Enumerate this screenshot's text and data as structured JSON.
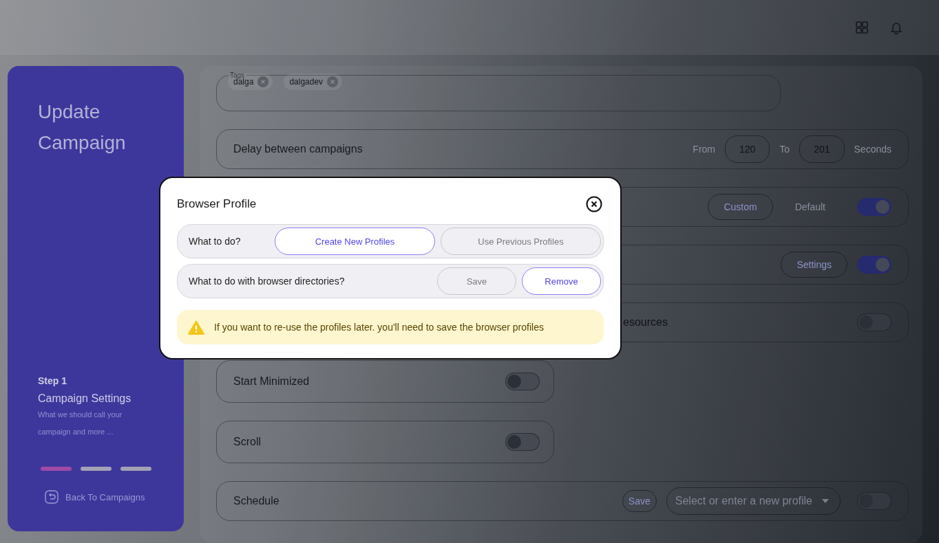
{
  "sidebar": {
    "title": "Update Campaign",
    "step_label": "Step 1",
    "step_title": "Campaign Settings",
    "step_description": "What we should call your campaign and more ...",
    "steps": [
      {
        "selected": true
      },
      {
        "selected": false
      },
      {
        "selected": false
      }
    ],
    "back_link": "Back To Campaigns"
  },
  "tags": {
    "legend": "Tags",
    "items": [
      "dalga",
      "dalgadev"
    ]
  },
  "rows": [
    {
      "kind": "range",
      "label": "Delay between campaigns",
      "from_label": "From",
      "from": "120",
      "to_label": "To",
      "to": "201",
      "unit": "Seconds"
    },
    {
      "kind": "choice",
      "buttons": [
        "Custom",
        "Default"
      ],
      "on": true
    },
    {
      "kind": "button",
      "button": "Settings",
      "on": true
    },
    {
      "kind": "partial",
      "label": "esources",
      "on": false
    },
    {
      "kind": "toggle",
      "label": "Start Minimized",
      "on": false
    },
    {
      "kind": "toggle",
      "label": "Scroll",
      "on": false
    },
    {
      "kind": "schedule",
      "label": "Schedule",
      "button": "Save",
      "placeholder": "Select or enter a new profile",
      "on": false
    }
  ],
  "modal": {
    "title": "Browser Profile",
    "questions": [
      {
        "label": "What to do?",
        "options": [
          {
            "label": "Create New Profiles",
            "selected": true
          },
          {
            "label": "Use Previous Profiles",
            "selected": false
          }
        ]
      },
      {
        "label": "What to do with browser directories?",
        "options": [
          {
            "label": "Save",
            "selected": false
          },
          {
            "label": "Remove",
            "selected": true
          }
        ]
      }
    ],
    "warning": "If you want to re-use the profiles later. you'll need to save the browser profiles"
  }
}
